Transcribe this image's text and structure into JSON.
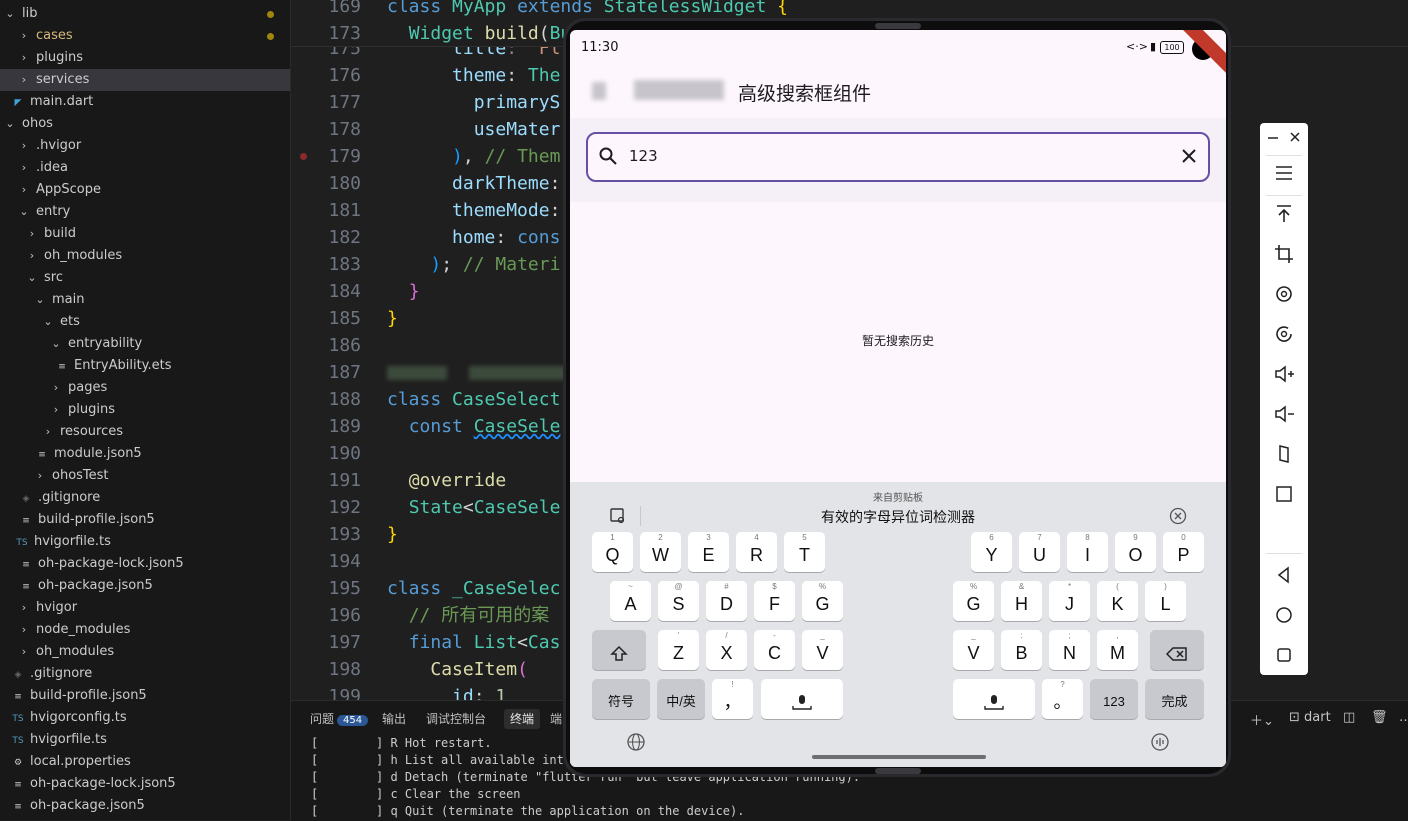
{
  "explorer": {
    "rows": [
      {
        "label": "lib",
        "twisty": "⌄",
        "icon": "",
        "modified": true
      },
      {
        "label": "cases",
        "twisty": "›",
        "icon": "",
        "modified": true
      },
      {
        "label": "plugins",
        "twisty": "›",
        "icon": "",
        "modified": false
      },
      {
        "label": "services",
        "twisty": "›",
        "icon": "",
        "modified": false
      },
      {
        "label": "main.dart",
        "twisty": "",
        "icon": "dart",
        "modified": false
      },
      {
        "label": "ohos",
        "twisty": "⌄",
        "icon": "",
        "modified": false
      },
      {
        "label": ".hvigor",
        "twisty": "›",
        "icon": "",
        "modified": false
      },
      {
        "label": ".idea",
        "twisty": "›",
        "icon": "",
        "modified": false
      },
      {
        "label": "AppScope",
        "twisty": "›",
        "icon": "",
        "modified": false
      },
      {
        "label": "entry",
        "twisty": "⌄",
        "icon": "",
        "modified": false
      },
      {
        "label": "build",
        "twisty": "›",
        "icon": "",
        "modified": false
      },
      {
        "label": "oh_modules",
        "twisty": "›",
        "icon": "",
        "modified": false
      },
      {
        "label": "src",
        "twisty": "⌄",
        "icon": "",
        "modified": false
      },
      {
        "label": "main",
        "twisty": "⌄",
        "icon": "",
        "modified": false
      },
      {
        "label": "ets",
        "twisty": "⌄",
        "icon": "",
        "modified": false
      },
      {
        "label": "entryability",
        "twisty": "⌄",
        "icon": "",
        "modified": false
      },
      {
        "label": "EntryAbility.ets",
        "twisty": "",
        "icon": "≡",
        "modified": false
      },
      {
        "label": "pages",
        "twisty": "›",
        "icon": "",
        "modified": false
      },
      {
        "label": "plugins",
        "twisty": "›",
        "icon": "",
        "modified": false
      },
      {
        "label": "resources",
        "twisty": "›",
        "icon": "",
        "modified": false
      },
      {
        "label": "module.json5",
        "twisty": "",
        "icon": "≡",
        "modified": false
      },
      {
        "label": "ohosTest",
        "twisty": "›",
        "icon": "",
        "modified": false
      },
      {
        "label": ".gitignore",
        "twisty": "",
        "icon": "◈",
        "modified": false
      },
      {
        "label": "build-profile.json5",
        "twisty": "",
        "icon": "≡",
        "modified": false
      },
      {
        "label": "hvigorfile.ts",
        "twisty": "",
        "icon": "TS",
        "modified": false
      },
      {
        "label": "oh-package-lock.json5",
        "twisty": "",
        "icon": "≡",
        "modified": false
      },
      {
        "label": "oh-package.json5",
        "twisty": "",
        "icon": "≡",
        "modified": false
      },
      {
        "label": "hvigor",
        "twisty": "›",
        "icon": "",
        "modified": false
      },
      {
        "label": "node_modules",
        "twisty": "›",
        "icon": "",
        "modified": false
      },
      {
        "label": "oh_modules",
        "twisty": "›",
        "icon": "",
        "modified": false
      },
      {
        "label": ".gitignore",
        "twisty": "",
        "icon": "◈",
        "modified": false
      },
      {
        "label": "build-profile.json5",
        "twisty": "",
        "icon": "≡",
        "modified": false
      },
      {
        "label": "hvigorconfig.ts",
        "twisty": "",
        "icon": "TS",
        "modified": false
      },
      {
        "label": "hvigorfile.ts",
        "twisty": "",
        "icon": "TS",
        "modified": false
      },
      {
        "label": "local.properties",
        "twisty": "",
        "icon": "⚙",
        "modified": false
      },
      {
        "label": "oh-package-lock.json5",
        "twisty": "",
        "icon": "≡",
        "modified": false
      },
      {
        "label": "oh-package.json5",
        "twisty": "",
        "icon": "≡",
        "modified": false
      }
    ]
  },
  "editor": {
    "sticky": [
      {
        "num": "169",
        "html": "<span class='kw'>class</span> <span class='ty'>MyApp</span> <span class='kw'>extends</span> <span class='ty'>StatelessWidget</span> <span class='br1'>{</span>"
      },
      {
        "num": "173",
        "html": "  <span class='ty'>Widget</span> <span class='fn'>build</span>(<span class='ty'>Bu</span>"
      }
    ],
    "lines": [
      {
        "num": "176",
        "html": "      <span class='pr'>theme</span>: <span class='ty'>The</span>"
      },
      {
        "num": "177",
        "html": "        <span class='pr'>primaryS</span>"
      },
      {
        "num": "178",
        "html": "        <span class='pr'>useMater</span>"
      },
      {
        "num": "179",
        "html": "      <span class='br3'>)</span>, <span class='cm'>// Them</span>"
      },
      {
        "num": "180",
        "html": "      <span class='pr'>darkTheme</span>:"
      },
      {
        "num": "181",
        "html": "      <span class='pr'>themeMode</span>:"
      },
      {
        "num": "182",
        "html": "      <span class='pr'>home</span>: <span class='kw'>cons</span>"
      },
      {
        "num": "183",
        "html": "    <span class='br3'>)</span>; <span class='cm'>// Materi</span>"
      },
      {
        "num": "184",
        "html": "  <span class='br2'>}</span>"
      },
      {
        "num": "185",
        "html": "<span class='br1'>}</span>"
      },
      {
        "num": "186",
        "html": ""
      },
      {
        "num": "187",
        "html": "<span class='blur' style='width:60px'></span>  <span class='blur' style='width:100px'></span>"
      },
      {
        "num": "188",
        "html": "<span class='kw'>class</span> <span class='ty'>CaseSelect</span>"
      },
      {
        "num": "189",
        "html": "  <span class='kw'>const</span> <span class='ty' style='text-decoration:underline wavy #1f8fff'>CaseSele</span>"
      },
      {
        "num": "190",
        "html": ""
      },
      {
        "num": "191",
        "html": "  <span class='an'>@override</span>"
      },
      {
        "num": "192",
        "html": "  <span class='ty'>State</span>&lt;<span class='ty'>CaseSele</span>"
      },
      {
        "num": "193",
        "html": "<span class='br1'>}</span>"
      },
      {
        "num": "194",
        "html": ""
      },
      {
        "num": "195",
        "html": "<span class='kw'>class</span> <span class='ty'>_CaseSelec</span>"
      },
      {
        "num": "196",
        "html": "  <span class='cm'>// 所有可用的案</span>"
      },
      {
        "num": "197",
        "html": "  <span class='kw'>final</span> <span class='ty'>List</span>&lt;<span class='ty'>Cas</span>"
      },
      {
        "num": "198",
        "html": "    <span class='fn'>CaseItem</span><span class='br2'>(</span>"
      },
      {
        "num": "199",
        "html": "      <span class='pr'>id</span>: <span style='color:#b5cea8'>1</span>"
      }
    ]
  },
  "panel": {
    "tabs": [
      {
        "label": "问题",
        "badge": "454"
      },
      {
        "label": "输出"
      },
      {
        "label": "调试控制台"
      },
      {
        "label": "终端",
        "active": true
      },
      {
        "label": "端"
      }
    ],
    "shell": "dart",
    "terminal": [
      "[        ] R Hot restart.",
      "[        ] h List all available interactive commands.",
      "[        ] d Detach (terminate \"flutter run\" but leave application running).",
      "[        ] c Clear the screen",
      "[        ] q Quit (terminate the application on the device)."
    ]
  },
  "device": {
    "status": {
      "time": "11:30",
      "battery": "100"
    },
    "app_title": "高级搜索框组件",
    "search": {
      "value": "123"
    },
    "empty_text": "暂无搜索历史",
    "keyboard": {
      "clipboard_title": "来自剪贴板",
      "clipboard_text": "有效的字母异位词检测器",
      "left_rows": [
        [
          {
            "k": "Q",
            "s": "1"
          },
          {
            "k": "W",
            "s": "2"
          },
          {
            "k": "E",
            "s": "3"
          },
          {
            "k": "R",
            "s": "4"
          },
          {
            "k": "T",
            "s": "5"
          }
        ],
        [
          {
            "k": "A",
            "s": "~"
          },
          {
            "k": "S",
            "s": "@"
          },
          {
            "k": "D",
            "s": "#"
          },
          {
            "k": "F",
            "s": "$"
          },
          {
            "k": "G",
            "s": "%"
          }
        ],
        [
          {
            "k": "Z",
            "s": "'"
          },
          {
            "k": "X",
            "s": "/"
          },
          {
            "k": "C",
            "s": "-"
          },
          {
            "k": "V",
            "s": "_"
          }
        ]
      ],
      "right_rows": [
        [
          {
            "k": "Y",
            "s": "6"
          },
          {
            "k": "U",
            "s": "7"
          },
          {
            "k": "I",
            "s": "8"
          },
          {
            "k": "O",
            "s": "9"
          },
          {
            "k": "P",
            "s": "0"
          }
        ],
        [
          {
            "k": "G",
            "s": "%"
          },
          {
            "k": "H",
            "s": "&"
          },
          {
            "k": "J",
            "s": "*"
          },
          {
            "k": "K",
            "s": "("
          },
          {
            "k": "L",
            "s": ")"
          }
        ],
        [
          {
            "k": "V",
            "s": "_"
          },
          {
            "k": "B",
            "s": ":"
          },
          {
            "k": "N",
            "s": ";"
          },
          {
            "k": "M",
            "s": ","
          }
        ]
      ],
      "symbols": "符号",
      "lang": "中/英",
      "comma": "，",
      "comma_sub": "!",
      "period": "。",
      "period_sub": "?",
      "num": "123",
      "done": "完成"
    }
  }
}
